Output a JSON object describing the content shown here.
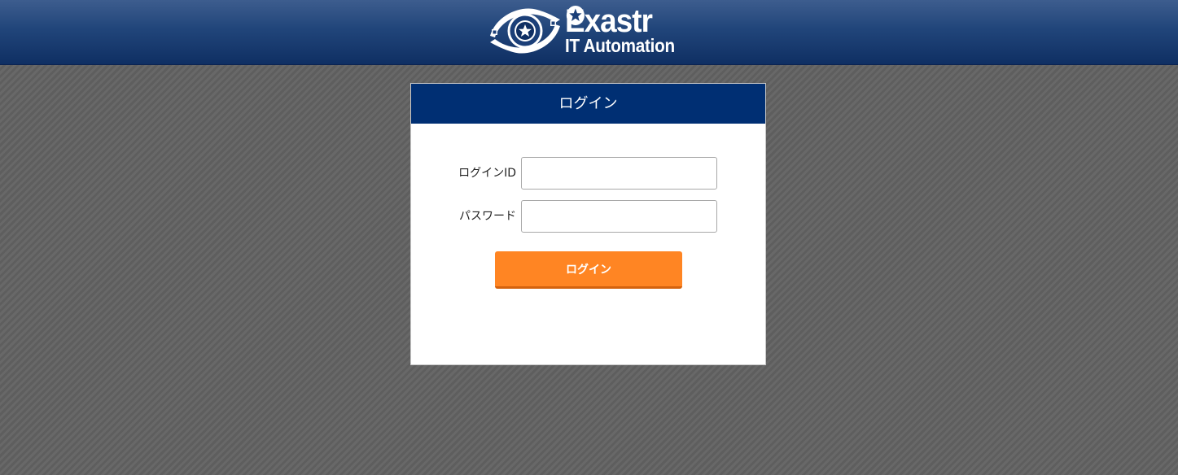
{
  "brand": {
    "name": "Exastr",
    "subtitle": "IT Automation",
    "logo_icon": "exastro-eye-star-icon",
    "colors": {
      "header_top": "#3d5d8e",
      "header_bottom": "#0f2f63",
      "panel_header": "#002f73",
      "button": "#ff8523",
      "button_shadow": "#d4620d"
    }
  },
  "login": {
    "title": "ログイン",
    "id_label": "ログインID",
    "id_value": "",
    "password_label": "パスワード",
    "password_value": "",
    "submit_label": "ログイン"
  }
}
